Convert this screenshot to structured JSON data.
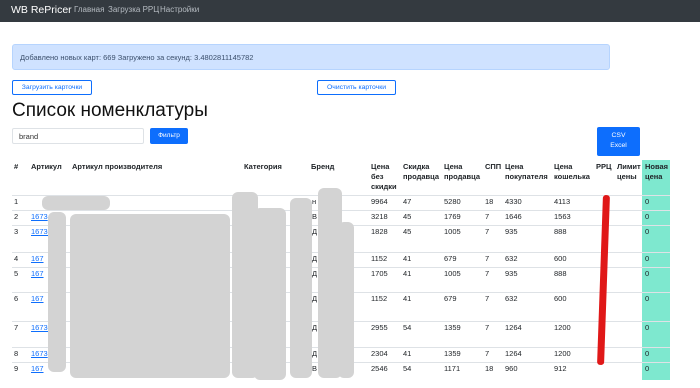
{
  "navbar": {
    "brand": "WB RePricer",
    "links": [
      "Главная",
      "Загрузка РРЦ",
      "Настройки"
    ]
  },
  "alert": {
    "message": "Добавлено новых карт: 669 Загружено за секунд: 3.4802811145782"
  },
  "buttons": {
    "upload_cards": "Загрузить карточки",
    "clear_cards": "Очистить карточки",
    "filter": "Фильтр",
    "csv_line1": "CSV",
    "csv_line2": "Excel"
  },
  "page_title": "Список номенклатуры",
  "filter": {
    "value": "brand"
  },
  "table": {
    "headers": {
      "num": "#",
      "article": "Артикул",
      "manufacturer_article": "Артикул производителя",
      "category": "Категория",
      "brand": "Бренд",
      "price_no_discount": "Цена без скидки",
      "seller_discount": "Скидка продавца",
      "seller_price": "Цена продавца",
      "spp": "СПП",
      "buyer_price": "Цена покупателя",
      "wallet_price": "Цена кошелька",
      "rrc": "РРЦ",
      "price_limit": "Лимит цены",
      "new_price": "Новая цена"
    },
    "rows": [
      {
        "num": "1",
        "article": "",
        "manufacturer_article": "",
        "category": "",
        "brand": "н",
        "price": "9964",
        "discount": "47",
        "seller_price": "5280",
        "spp": "18",
        "buyer_price": "4330",
        "wallet_price": "4113",
        "new_price": "0"
      },
      {
        "num": "2",
        "article": "1673",
        "manufacturer_article": "",
        "category": "вые",
        "brand": "В",
        "price": "3218",
        "discount": "45",
        "seller_price": "1769",
        "spp": "7",
        "buyer_price": "1646",
        "wallet_price": "1563",
        "new_price": "0"
      },
      {
        "num": "3",
        "article": "167302",
        "manufacturer_article": "",
        "category": "",
        "brand": "Д",
        "price": "1828",
        "discount": "45",
        "seller_price": "1005",
        "spp": "7",
        "buyer_price": "935",
        "wallet_price": "888",
        "new_price": "0"
      },
      {
        "num": "4",
        "article": "167",
        "manufacturer_article": "з шт",
        "category": "",
        "brand": "Д",
        "price": "1152",
        "discount": "41",
        "seller_price": "679",
        "spp": "7",
        "buyer_price": "632",
        "wallet_price": "600",
        "new_price": "0"
      },
      {
        "num": "5",
        "article": "167",
        "manufacturer_article": "",
        "category": "",
        "brand": "Д",
        "price": "1705",
        "discount": "41",
        "seller_price": "1005",
        "spp": "7",
        "buyer_price": "935",
        "wallet_price": "888",
        "new_price": "0"
      },
      {
        "num": "6",
        "article": "167",
        "manufacturer_article": "ей и",
        "category": "С",
        "brand": "Д",
        "price": "1152",
        "discount": "41",
        "seller_price": "679",
        "spp": "7",
        "buyer_price": "632",
        "wallet_price": "600",
        "new_price": "0"
      },
      {
        "num": "7",
        "article": "16730",
        "manufacturer_article": "ар",
        "category": "С",
        "brand": "Д",
        "price": "2955",
        "discount": "54",
        "seller_price": "1359",
        "spp": "7",
        "buyer_price": "1264",
        "wallet_price": "1200",
        "new_price": "0"
      },
      {
        "num": "8",
        "article": "1673",
        "manufacturer_article": "",
        "category": "",
        "brand": "Д",
        "price": "2304",
        "discount": "41",
        "seller_price": "1359",
        "spp": "7",
        "buyer_price": "1264",
        "wallet_price": "1200",
        "new_price": "0"
      },
      {
        "num": "9",
        "article": "167",
        "manufacturer_article": "а",
        "category": "Кр",
        "brand": "В",
        "price": "2546",
        "discount": "54",
        "seller_price": "1171",
        "spp": "18",
        "buyer_price": "960",
        "wallet_price": "912",
        "new_price": "0"
      }
    ]
  },
  "colors": {
    "navbar_bg": "#343a40",
    "primary": "#0d6efd",
    "alert_bg": "#cfe2ff",
    "new_price_col": "#7ee8cf",
    "redaction": "#d3d3d3",
    "annotation_red": "#e01818"
  }
}
